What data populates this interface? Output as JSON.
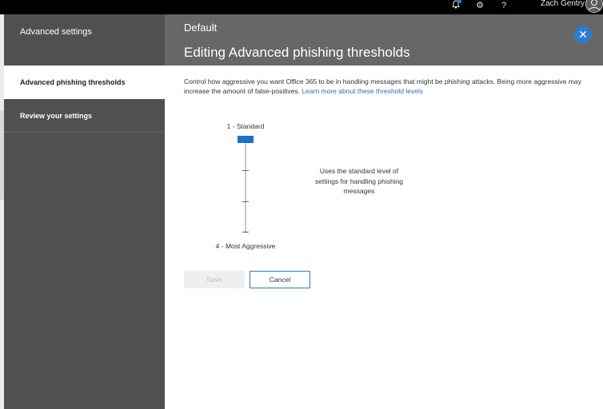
{
  "topbar": {
    "user_name": "Zach Gentry",
    "icons": [
      "notification-bell-icon",
      "gear-icon",
      "help-icon",
      "avatar-icon"
    ],
    "help_glyph": "?",
    "gear_glyph": "⚙"
  },
  "sidebar": {
    "title": "Advanced settings",
    "items": [
      {
        "label": "Advanced phishing thresholds",
        "active": true
      },
      {
        "label": "Review your settings",
        "active": false
      }
    ]
  },
  "header": {
    "subtitle": "Default",
    "title": "Editing Advanced phishing thresholds",
    "close_glyph": "✕"
  },
  "main": {
    "description": "Control how aggressive you want Office 365 to be in handling messages that might be phishing attacks. Being more aggressive may increase the amount of false-positives.",
    "learn_more_link": "Learn more about these threshold levels",
    "slider": {
      "min_label": "1 - Standard",
      "max_label": "4 - Most Aggressive",
      "levels": 4,
      "value": 1,
      "level_description": "Uses the standard level of settings for handling phishing messages"
    },
    "buttons": {
      "save_label": "Save",
      "cancel_label": "Cancel"
    }
  },
  "colors": {
    "accent": "#2b7bd0",
    "sidebar_bg": "#505050",
    "header_bg": "#676767",
    "topbar_bg": "#000000"
  }
}
